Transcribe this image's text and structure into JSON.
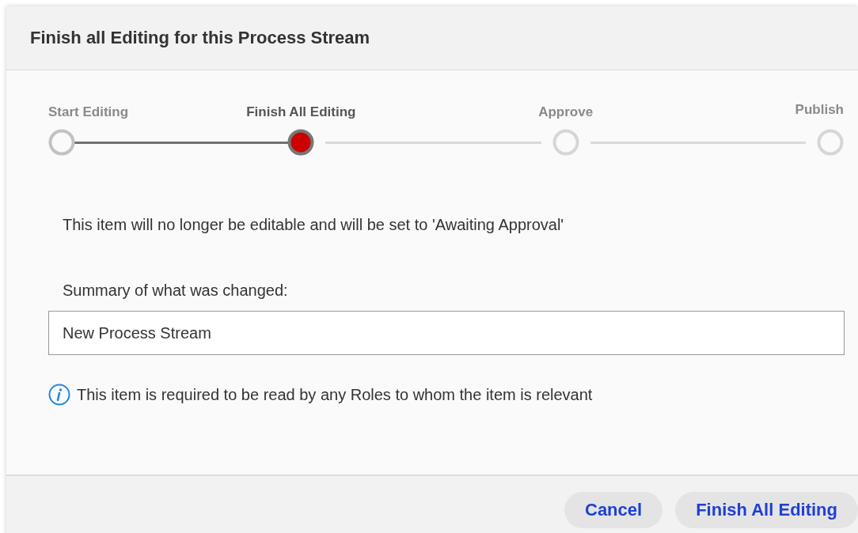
{
  "dialog": {
    "title": "Finish all Editing for this Process Stream"
  },
  "steps": [
    {
      "label": "Start Editing",
      "completed": true,
      "selected": false
    },
    {
      "label": "Finish All Editing",
      "completed": false,
      "selected": true
    },
    {
      "label": "Approve",
      "completed": false,
      "selected": false
    },
    {
      "label": "Publish",
      "completed": false,
      "selected": false
    }
  ],
  "message": "This item will no longer be editable and will be set to 'Awaiting Approval'",
  "summary": {
    "label": "Summary of what was changed:",
    "value": "New Process Stream"
  },
  "info": "This item is required to be read by any Roles to whom the item is relevant",
  "buttons": [
    "Cancel",
    "Finish All Editing"
  ]
}
